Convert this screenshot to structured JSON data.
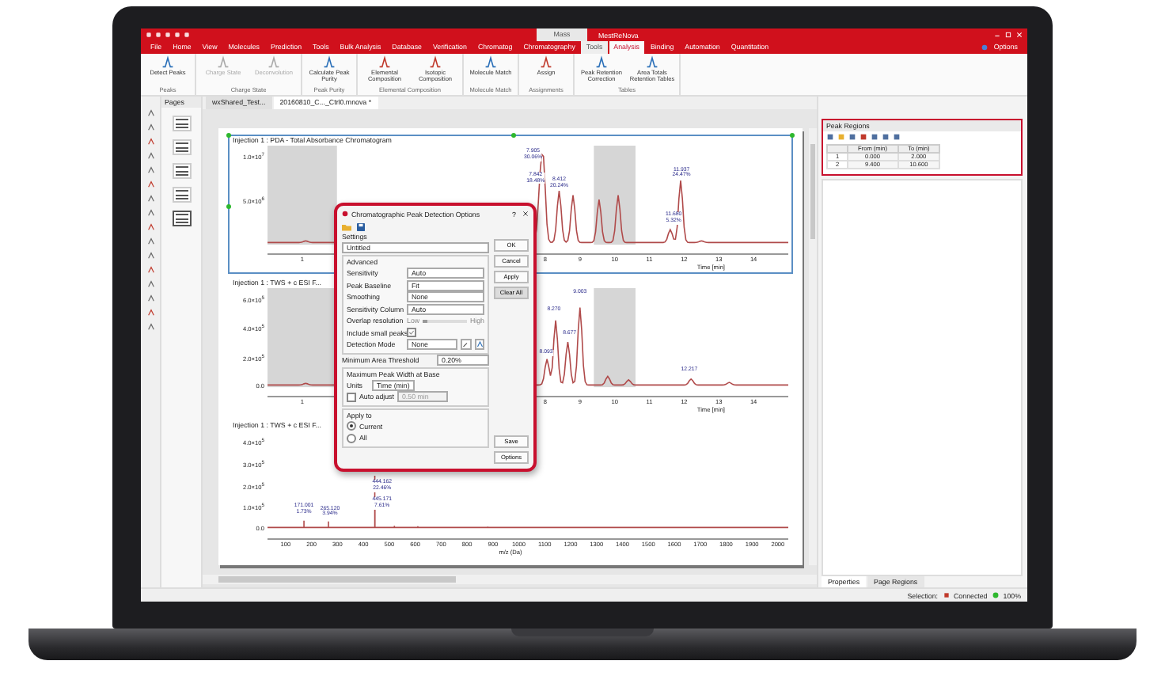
{
  "app_title": "MestReNova",
  "context_group": "Mass",
  "menu_tabs": [
    {
      "label": "File",
      "selected": false
    },
    {
      "label": "Home",
      "selected": false
    },
    {
      "label": "View",
      "selected": false
    },
    {
      "label": "Molecules",
      "selected": false
    },
    {
      "label": "Prediction",
      "selected": false
    },
    {
      "label": "Tools",
      "selected": false
    },
    {
      "label": "Bulk Analysis",
      "selected": false
    },
    {
      "label": "Database",
      "selected": false
    },
    {
      "label": "Verification",
      "selected": false
    },
    {
      "label": "Chromatog",
      "selected": false
    },
    {
      "label": "Chromatography",
      "selected": false
    },
    {
      "label": "Tools",
      "selected": false
    },
    {
      "label": "Analysis",
      "selected": true
    },
    {
      "label": "Binding",
      "selected": false
    },
    {
      "label": "Automation",
      "selected": false
    },
    {
      "label": "Quantitation",
      "selected": false
    }
  ],
  "options_label": "Options",
  "ribbon_groups": [
    {
      "label": "Peaks",
      "buttons": [
        {
          "label": "Detect Peaks",
          "disabled": false
        }
      ]
    },
    {
      "label": "Charge State",
      "buttons": [
        {
          "label": "Charge State",
          "disabled": true
        },
        {
          "label": "Deconvolution",
          "disabled": true
        }
      ]
    },
    {
      "label": "Peak Purity",
      "buttons": [
        {
          "label": "Calculate Peak Purity",
          "disabled": false
        }
      ]
    },
    {
      "label": "Elemental Composition",
      "buttons": [
        {
          "label": "Elemental Composition",
          "disabled": false
        },
        {
          "label": "Isotopic Composition",
          "disabled": false
        }
      ]
    },
    {
      "label": "Molecule Match",
      "buttons": [
        {
          "label": "Molecule Match",
          "disabled": false
        }
      ]
    },
    {
      "label": "Assignments",
      "buttons": [
        {
          "label": "Assign",
          "disabled": false
        }
      ]
    },
    {
      "label": "Tables",
      "buttons": [
        {
          "label": "Peak Retention Correction",
          "disabled": false
        },
        {
          "label": "Area Totals Retention Tables",
          "disabled": false
        }
      ]
    }
  ],
  "pages_panel": {
    "title": "Pages",
    "pages": [
      {
        "selected": false
      },
      {
        "selected": false
      },
      {
        "selected": false
      },
      {
        "selected": false
      },
      {
        "selected": true
      }
    ]
  },
  "doc_tabs": [
    {
      "label": "wxShared_Test...",
      "selected": false
    },
    {
      "label": "20160810_C..._Ctrl0.mnova *",
      "selected": true
    }
  ],
  "charts": [
    {
      "kind": "chromatogram",
      "selected": true,
      "title": "Injection 1 : PDA - Total Absorbance Chromatogram",
      "y_ticks": [
        "1.0×10$^{7}$",
        "5.0×10$^{6}$"
      ],
      "x_ticks": [
        "1",
        "8",
        "9",
        "10",
        "11",
        "12",
        "13",
        "14"
      ],
      "x_label": "Time [min]",
      "peak_labels": [
        {
          "value": "7.905",
          "share": "30.06%"
        },
        {
          "value": "7.842",
          "share": "18.48%"
        },
        {
          "value": "8.412",
          "share": "20.24%"
        },
        {
          "value": "11.680",
          "share": "5.32%"
        },
        {
          "value": "11.937",
          "share": "24.47%"
        }
      ]
    },
    {
      "kind": "chromatogram",
      "selected": false,
      "title": "Injection 1 : TWS + c ESI F...",
      "y_ticks": [
        "6.0×10$^{5}$",
        "4.0×10$^{5}$",
        "2.0×10$^{5}$",
        "0.0"
      ],
      "x_ticks": [
        "1",
        "8",
        "9",
        "10",
        "11",
        "12",
        "13",
        "14"
      ],
      "x_label": "Time [min]",
      "peak_labels": [
        {
          "value": "8.093"
        },
        {
          "value": "8.270"
        },
        {
          "value": "8.677"
        },
        {
          "value": "9.003"
        },
        {
          "value": "12.217"
        }
      ]
    },
    {
      "kind": "spectrum",
      "selected": false,
      "title": "Injection 1 : TWS + c ESI F...",
      "y_ticks": [
        "4.0×10$^{5}$",
        "3.0×10$^{5}$",
        "2.0×10$^{5}$",
        "1.0×10$^{5}$",
        "0.0"
      ],
      "x_ticks": [
        "100",
        "200",
        "300",
        "400",
        "500",
        "600",
        "700",
        "800",
        "900",
        "1000",
        "1100",
        "1200",
        "1300",
        "1400",
        "1500",
        "1600",
        "1700",
        "1800",
        "1900",
        "2000"
      ],
      "x_label": "m/z (Da)",
      "peak_labels": [
        {
          "value": "171.001",
          "share": "1.73%"
        },
        {
          "value": "265.120",
          "share": "3.94%"
        },
        {
          "value": "444.162",
          "share": "22.46%"
        },
        {
          "value": "445.171",
          "share": "7.61%"
        }
      ]
    }
  ],
  "dialog": {
    "title": "Chromatographic Peak Detection Options",
    "help": "?",
    "settings_label": "Settings",
    "settings_value": "Untitled",
    "advanced_label": "Advanced",
    "fields": [
      {
        "kind": "select",
        "label": "Sensitivity",
        "value": "Auto"
      },
      {
        "kind": "select",
        "label": "Peak Baseline",
        "value": "Fit"
      },
      {
        "kind": "select",
        "label": "Smoothing",
        "value": "None"
      },
      {
        "kind": "select",
        "label": "Sensitivity Column",
        "value": "Auto"
      },
      {
        "kind": "slider",
        "label": "Overlap resolution",
        "min_label": "Low",
        "max_label": "High",
        "level": 0.1
      },
      {
        "kind": "check",
        "label": "Include small peaks",
        "checked": true
      },
      {
        "kind": "select_tools",
        "label": "Detection Mode",
        "value": "None"
      }
    ],
    "threshold_label": "Minimum Area Threshold",
    "threshold_value": "0.20%",
    "width_group": "Maximum Peak Width at Base",
    "units_label": "Units",
    "units_value": "Time (min)",
    "auto_label": "Auto adjust",
    "auto_checked": false,
    "auto_value": "0.50 min",
    "apply_label": "Apply to",
    "apply_options": [
      {
        "label": "Current",
        "selected": true
      },
      {
        "label": "All",
        "selected": false
      }
    ],
    "side_buttons": [
      {
        "label": "OK",
        "selected": false
      },
      {
        "label": "Cancel",
        "selected": false
      },
      {
        "label": "Apply",
        "selected": false
      },
      {
        "label": "Clear All",
        "selected": true
      }
    ],
    "bottom_buttons": [
      "Save",
      "Options"
    ]
  },
  "right_panel": {
    "title": "Peak Regions",
    "columns": [
      "From (min)",
      "To (min)"
    ],
    "rows": [
      {
        "index": "1",
        "cells": [
          "0.000",
          "2.000"
        ]
      },
      {
        "index": "2",
        "cells": [
          "9.400",
          "10.600"
        ]
      }
    ],
    "bottom_tabs": [
      {
        "label": "Properties",
        "selected": true
      },
      {
        "label": "Page Regions",
        "selected": false
      }
    ]
  },
  "status_bar": {
    "selection_label": "Selection:",
    "connection_label": "Connected",
    "connected": true,
    "zoom": "100%"
  }
}
